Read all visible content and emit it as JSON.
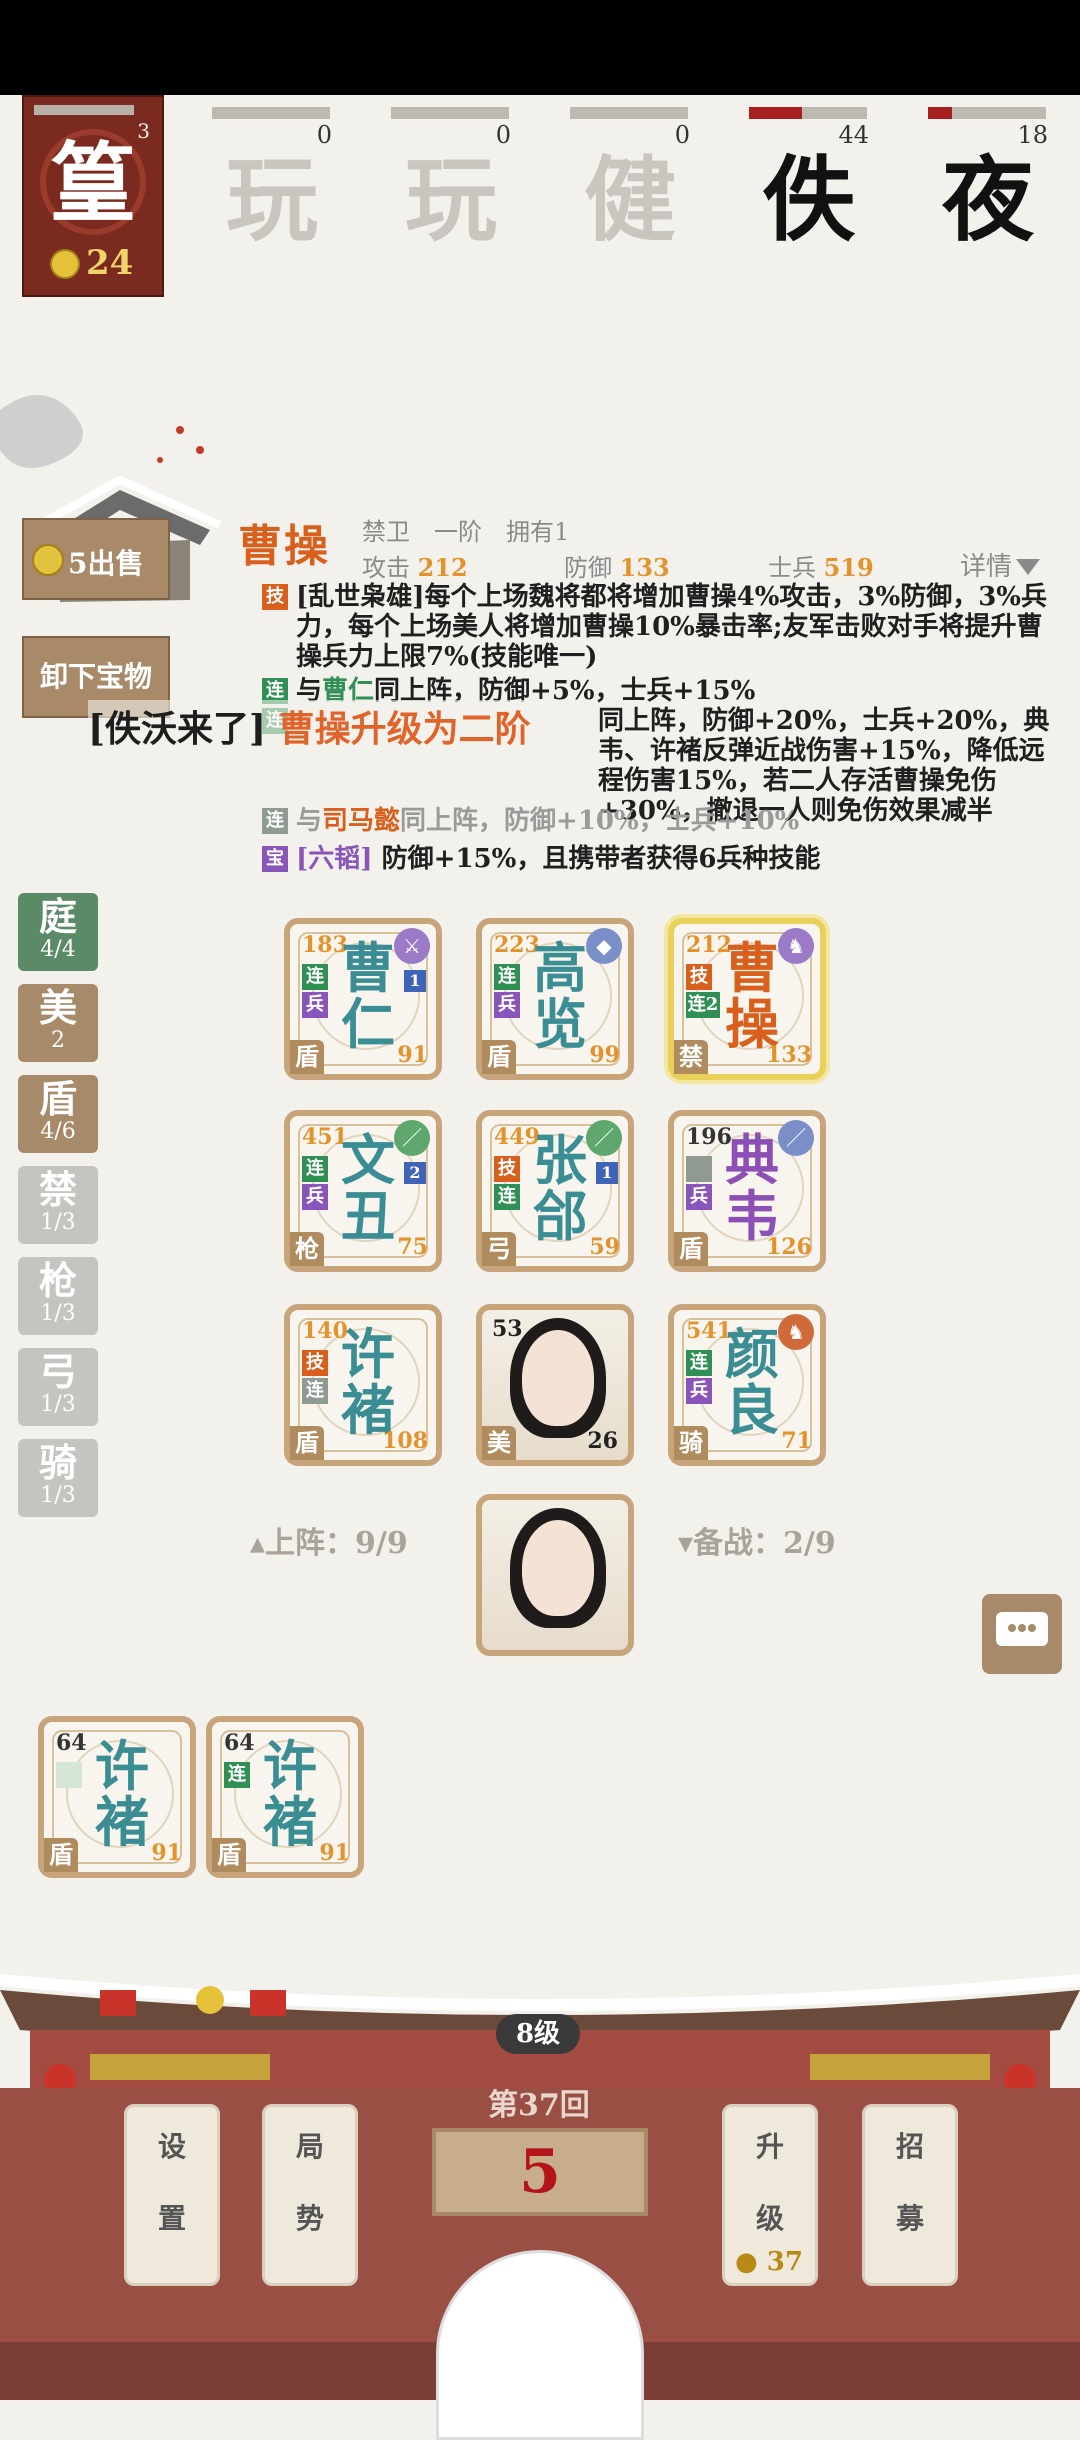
{
  "me": {
    "glyph": "篁",
    "hp_num": "3",
    "gold": "24"
  },
  "opponents": [
    {
      "glyph": "玩",
      "num": "0",
      "hp": 0.0,
      "style": "faded"
    },
    {
      "glyph": "玩",
      "num": "0",
      "hp": 0.0,
      "style": "faded"
    },
    {
      "glyph": "健",
      "num": "0",
      "hp": 0.0,
      "style": "faded"
    },
    {
      "glyph": "佚",
      "num": "44",
      "hp": 0.45,
      "style": "dark"
    },
    {
      "glyph": "夜",
      "num": "18",
      "hp": 0.2,
      "style": "dark"
    }
  ],
  "left_buttons": {
    "sell_price": "5",
    "sell_label": "出售",
    "unload_label": "卸下宝物"
  },
  "hero": {
    "name": "曹操",
    "sub": "禁卫　一阶　拥有1",
    "attack_label": "攻击",
    "attack": "212",
    "defense_label": "防御",
    "defense": "133",
    "soldier_label": "士兵",
    "soldiers": "519",
    "detail_label": "详情",
    "skill_tag": "技",
    "skill_text": "[乱世枭雄]每个上场魏将都将增加曹操4%攻击，3%防御，3%兵力，每个上场美人将增加曹操10%暴击率;友军击败对手将提升曹操兵力上限7%(技能唯一)",
    "link1_tag": "连",
    "link1_prefix": "与",
    "link1_name": "曹仁",
    "link1_text": "同上阵，防御+5%，士兵+15%",
    "link2_tag": "连",
    "link2_text": "同上阵，防御+20%，士兵+20%，典韦、许褚反弹近战伤害+15%，降低远程伤害15%，若二人存活曹操免伤+30%，撤退一人则免伤效果减半",
    "link3_tag": "连",
    "link3_prefix": "与",
    "link3_name": "司马懿",
    "link3_text": "同上阵，防御+10%，士兵+10%",
    "treasure_tag": "宝",
    "treasure_name": "[六韬]",
    "treasure_text": "防御+15%，且携带者获得6兵种技能"
  },
  "toast": {
    "prefix": "[佚沃来了]",
    "highlight": "曹操升级为二阶"
  },
  "categories": [
    {
      "k": "庭",
      "v": "4/4",
      "style": "g"
    },
    {
      "k": "美",
      "v": "2",
      "style": "b"
    },
    {
      "k": "盾",
      "v": "4/6",
      "style": "b"
    },
    {
      "k": "禁",
      "v": "1/3",
      "style": "x"
    },
    {
      "k": "枪",
      "v": "1/3",
      "style": "x"
    },
    {
      "k": "弓",
      "v": "1/3",
      "style": "x"
    },
    {
      "k": "骑",
      "v": "1/3",
      "style": "x"
    }
  ],
  "board": [
    {
      "n1": "曹",
      "n2": "仁",
      "atk": "183",
      "def": "91",
      "type": "盾",
      "lvl": "1",
      "t1": "连",
      "t2": "兵",
      "color": "teal"
    },
    {
      "n1": "高",
      "n2": "览",
      "atk": "223",
      "def": "99",
      "type": "盾",
      "lvl": "",
      "t1": "连",
      "t2": "兵",
      "color": "teal"
    },
    {
      "n1": "曹",
      "n2": "操",
      "atk": "212",
      "def": "133",
      "type": "禁",
      "lvl": "",
      "t1": "技",
      "t2": "连2",
      "color": "orng"
    },
    {
      "n1": "文",
      "n2": "丑",
      "atk": "451",
      "def": "75",
      "type": "枪",
      "lvl": "2",
      "t1": "连",
      "t2": "兵",
      "color": "teal"
    },
    {
      "n1": "张",
      "n2": "郃",
      "atk": "449",
      "def": "59",
      "type": "弓",
      "lvl": "1",
      "t1": "技",
      "t2": "连",
      "color": "teal"
    },
    {
      "n1": "典",
      "n2": "韦",
      "atk": "196",
      "def": "126",
      "type": "盾",
      "lvl": "",
      "t1": "",
      "t2": "兵",
      "color": "purp"
    },
    {
      "n1": "许",
      "n2": "褚",
      "atk": "140",
      "def": "108",
      "type": "盾",
      "lvl": "",
      "t1": "技",
      "t2": "连",
      "color": "teal"
    },
    {
      "atk": "53",
      "def": "26",
      "type": "美",
      "portrait": true
    },
    {
      "n1": "颜",
      "n2": "良",
      "atk": "541",
      "def": "71",
      "type": "骑",
      "lvl": "",
      "t1": "连",
      "t2": "兵",
      "color": "teal"
    }
  ],
  "on_field": "上阵：9/9",
  "bench_label": "备战：2/9",
  "bench": [
    {
      "n1": "许",
      "n2": "褚",
      "atk": "64",
      "def": "91",
      "type": "盾",
      "t1": ""
    },
    {
      "n1": "许",
      "n2": "褚",
      "atk": "64",
      "def": "91",
      "type": "盾",
      "t1": "连"
    }
  ],
  "bottom": {
    "level": "8级",
    "round": "第37回",
    "countdown": "5",
    "btn_settings_a": "设",
    "btn_settings_b": "置",
    "btn_situation_a": "局",
    "btn_situation_b": "势",
    "btn_upgrade_a": "升",
    "btn_upgrade_b": "级",
    "upgrade_cost": "37",
    "btn_recruit_a": "招",
    "btn_recruit_b": "募"
  }
}
